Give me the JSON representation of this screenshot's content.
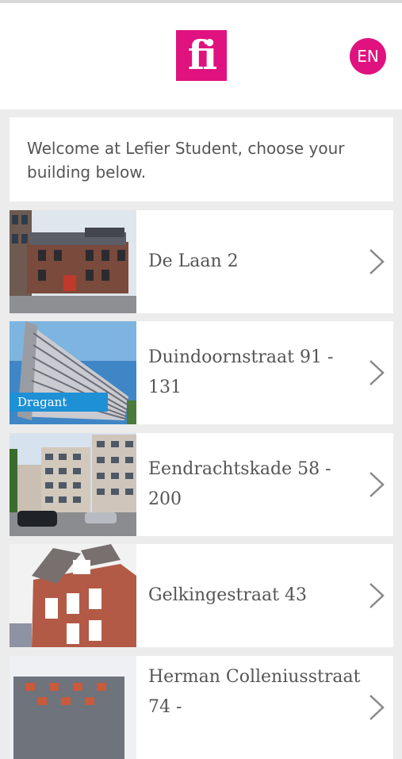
{
  "header": {
    "logo_text": "fi",
    "language": "EN"
  },
  "welcome_text": "Welcome at Lefier Student, choose your building below.",
  "buildings": [
    {
      "name": "De Laan 2",
      "tag": ""
    },
    {
      "name": "Duindoornstraat 91 - 131",
      "tag": "Dragant"
    },
    {
      "name": "Eendrachtskade 58 - 200",
      "tag": ""
    },
    {
      "name": "Gelkingestraat 43",
      "tag": ""
    },
    {
      "name": "Herman Colleniusstraat 74 -",
      "tag": ""
    }
  ],
  "colors": {
    "brand": "#e0127f",
    "tag": "#1e90d6",
    "background": "#ececec"
  },
  "icons": {
    "chevron": "chevron-right-icon"
  }
}
